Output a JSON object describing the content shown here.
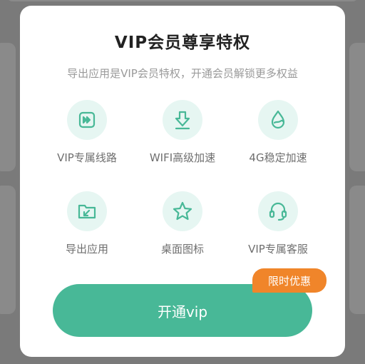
{
  "dialog": {
    "title": "VIP会员尊享特权",
    "subtitle": "导出应用是VIP会员特权，开通会员解锁更多权益",
    "features": [
      {
        "label": "VIP专属线路",
        "icon": "fast-forward-icon"
      },
      {
        "label": "WIFI高级加速",
        "icon": "download-arrow-icon"
      },
      {
        "label": "4G稳定加速",
        "icon": "water-drop-icon"
      },
      {
        "label": "导出应用",
        "icon": "folder-export-icon"
      },
      {
        "label": "桌面图标",
        "icon": "star-icon"
      },
      {
        "label": "VIP专属客服",
        "icon": "headset-icon"
      }
    ],
    "cta_label": "开通vip",
    "badge_label": "限时优惠"
  },
  "colors": {
    "accent": "#48b897",
    "icon_bg": "#e6f6f2",
    "badge": "#f0852a",
    "overlay": "#7a7a7a"
  }
}
